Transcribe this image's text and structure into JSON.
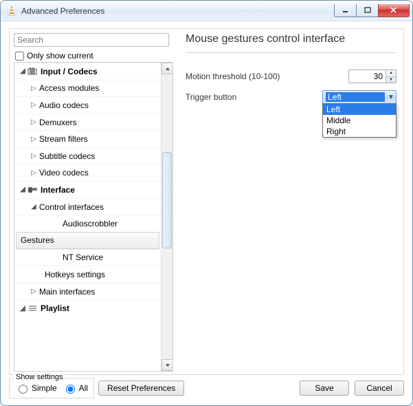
{
  "window": {
    "title": "Advanced Preferences"
  },
  "search": {
    "placeholder": "Search"
  },
  "only_show_current": "Only show current",
  "tree": {
    "input_codecs": "Input / Codecs",
    "access_modules": "Access modules",
    "audio_codecs": "Audio codecs",
    "demuxers": "Demuxers",
    "stream_filters": "Stream filters",
    "subtitle_codecs": "Subtitle codecs",
    "video_codecs": "Video codecs",
    "interface": "Interface",
    "control_interfaces": "Control interfaces",
    "audioscrobbler": "Audioscrobbler",
    "gestures": "Gestures",
    "nt_service": "NT Service",
    "hotkeys_settings": "Hotkeys settings",
    "main_interfaces": "Main interfaces",
    "playlist": "Playlist"
  },
  "panel": {
    "heading": "Mouse gestures control interface",
    "motion_threshold_label": "Motion threshold (10-100)",
    "motion_threshold_value": "30",
    "trigger_button_label": "Trigger button",
    "trigger_selected": "Left",
    "trigger_options": {
      "left": "Left",
      "middle": "Middle",
      "right": "Right"
    }
  },
  "footer": {
    "legend": "Show settings",
    "simple": "Simple",
    "all": "All",
    "reset": "Reset Preferences",
    "save": "Save",
    "cancel": "Cancel"
  }
}
